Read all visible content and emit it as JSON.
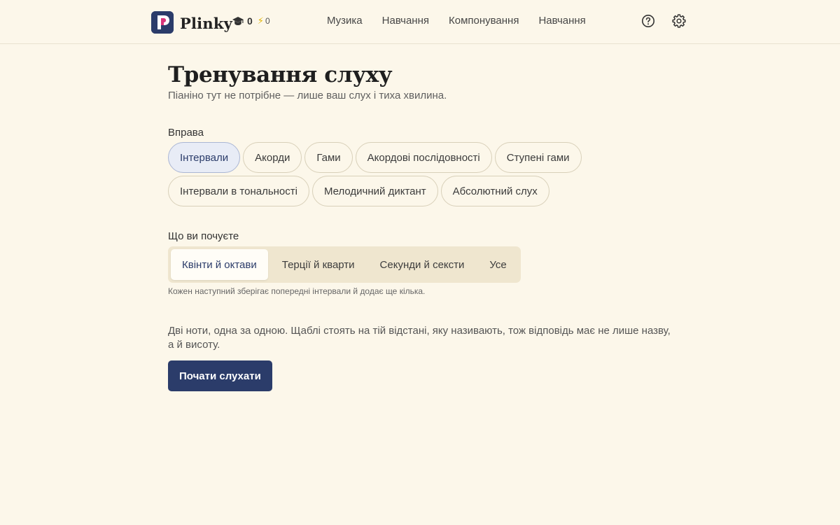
{
  "app": {
    "brand_name": "Plinky",
    "logo_letter": "P",
    "colors": {
      "accent": "#2b3c6a",
      "logo_pink": "#d9357a",
      "background": "#fcf7ea"
    }
  },
  "stats": {
    "courses_icon": "graduation-cap-icon",
    "courses_count": "0",
    "streak_icon": "lightning-icon",
    "streak_glyph": "⚡",
    "streak_count": "0"
  },
  "nav": {
    "items": [
      {
        "label": "Музика"
      },
      {
        "label": "Навчання"
      },
      {
        "label": "Компонування"
      },
      {
        "label": "Навчання"
      }
    ]
  },
  "top_icons": {
    "help": "help-circle-icon",
    "settings": "gear-icon"
  },
  "page": {
    "title": "Тренування слуху",
    "subtitle": "Піаніно тут не потрібне — лише ваш слух і тиха хвилина."
  },
  "exercise": {
    "label": "Вправа",
    "selected": "Інтервали",
    "options": [
      {
        "label": "Інтервали"
      },
      {
        "label": "Акорди"
      },
      {
        "label": "Гами"
      },
      {
        "label": "Акордові послідовності"
      },
      {
        "label": "Ступені гами"
      },
      {
        "label": "Інтервали в тональності"
      },
      {
        "label": "Мелодичний диктант"
      },
      {
        "label": "Абсолютний слух"
      }
    ]
  },
  "hear": {
    "label": "Що ви почуєте",
    "selected": "Квінти й октави",
    "options": [
      {
        "label": "Квінти й октави"
      },
      {
        "label": "Терції й кварти"
      },
      {
        "label": "Секунди й сексти"
      },
      {
        "label": "Усе"
      }
    ],
    "hint": "Кожен наступний зберігає попередні інтервали й додає ще кілька."
  },
  "description": "Дві ноти, одна за одною. Щаблі стоять на тій відстані, яку називають, тож відповідь має не лише назву, а й висоту.",
  "start_button": "Почати слухати"
}
